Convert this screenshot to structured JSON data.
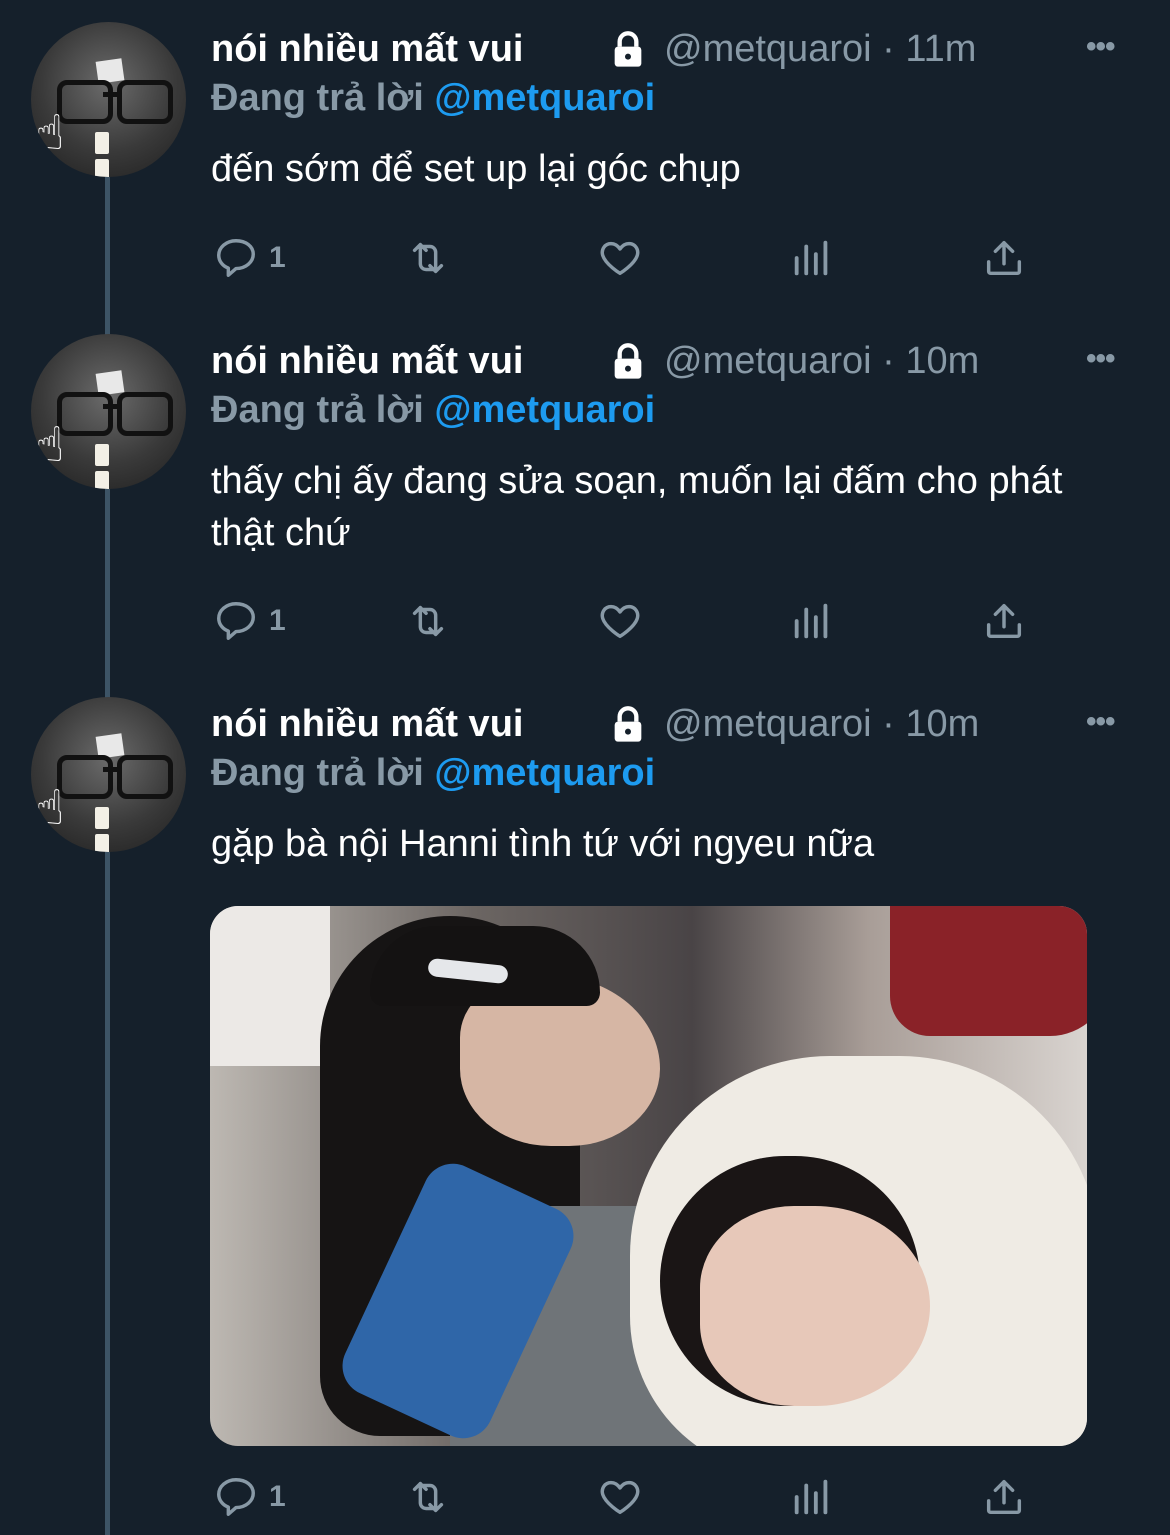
{
  "tweets": [
    {
      "display_name": "nói nhiều mất vui",
      "handle": "@metquaroi",
      "time": "· 11m",
      "replying_prefix": "Đang trả lời",
      "replying_to": "@metquaroi",
      "text": "đến sớm để set up lại góc chụp",
      "reply_count": "1",
      "has_media": false
    },
    {
      "display_name": "nói nhiều mất vui",
      "handle": "@metquaroi",
      "time": "· 10m",
      "replying_prefix": "Đang trả lời",
      "replying_to": "@metquaroi",
      "text": "thấy chị ấy đang sửa soạn, muốn lại đấm cho phát thật chứ",
      "reply_count": "1",
      "has_media": false
    },
    {
      "display_name": "nói nhiều mất vui",
      "handle": "@metquaroi",
      "time": "· 10m",
      "replying_prefix": "Đang trả lời",
      "replying_to": "@metquaroi",
      "text": "gặp bà nội Hanni tình tứ với ngyeu nữa",
      "reply_count": "1",
      "has_media": true
    }
  ],
  "icons": {
    "reply": "reply-icon",
    "retweet": "retweet-icon",
    "like": "heart-icon",
    "views": "analytics-icon",
    "share": "share-icon",
    "more": "more-icon",
    "lock": "lock-icon"
  },
  "colors": {
    "background": "#15202b",
    "muted": "#8899a6",
    "mention": "#1d9bf0",
    "thread_line": "#3d5466"
  }
}
